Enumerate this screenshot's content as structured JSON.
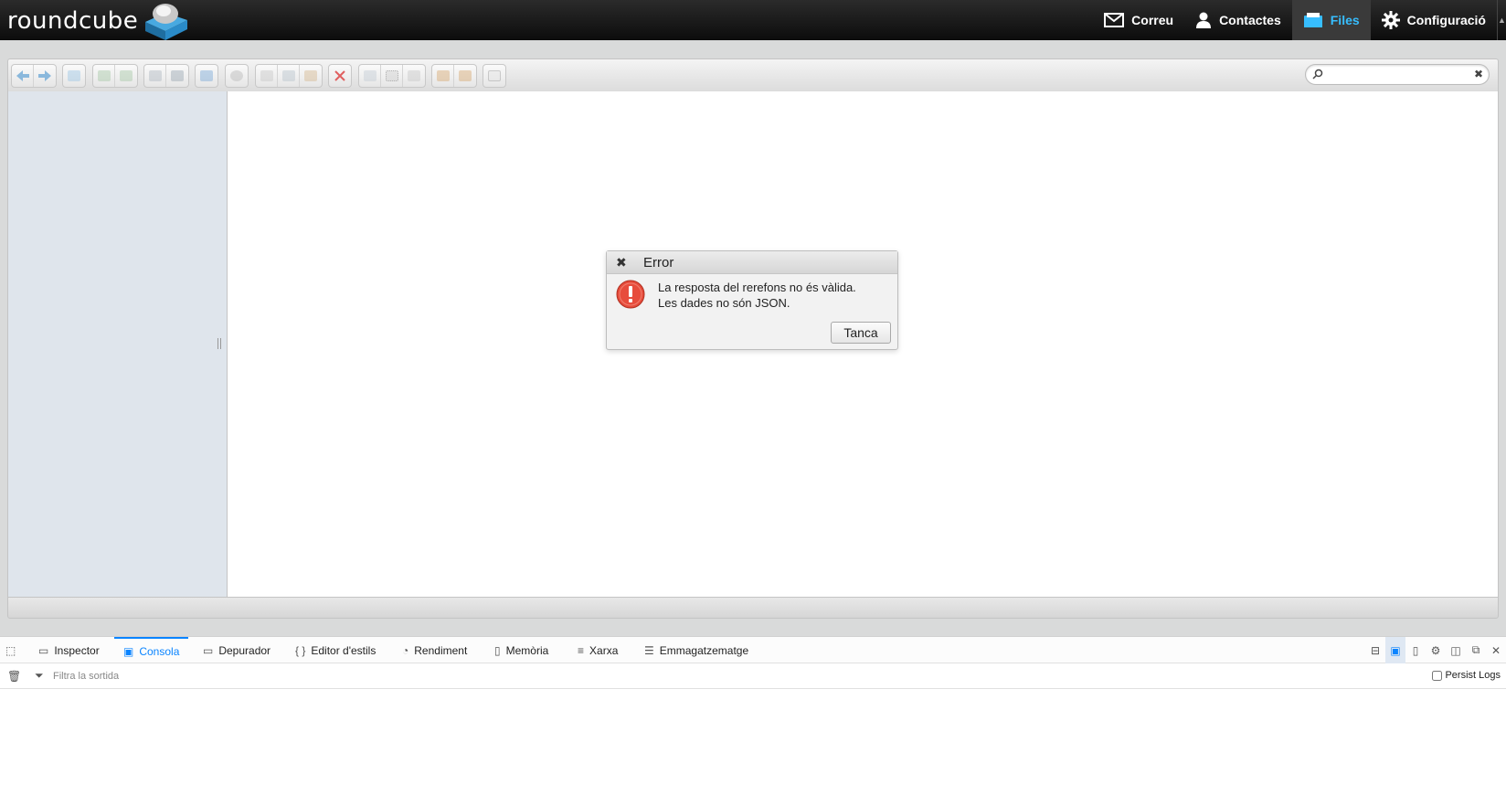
{
  "logo": {
    "text": "roundcube"
  },
  "nav": [
    {
      "label": "Correu",
      "icon": "envelope-icon"
    },
    {
      "label": "Contactes",
      "icon": "user-icon"
    },
    {
      "label": "Files",
      "icon": "folder-icon",
      "active": true
    },
    {
      "label": "Configuració",
      "icon": "gear-icon"
    }
  ],
  "search": {
    "placeholder": "",
    "value": ""
  },
  "dialog": {
    "title": "Error",
    "message_line1": "La resposta del rerefons no és vàlida.",
    "message_line2": "Les dades no són JSON.",
    "button": "Tanca"
  },
  "devtools": {
    "tabs": [
      {
        "label": "Inspector"
      },
      {
        "label": "Consola",
        "active": true
      },
      {
        "label": "Depurador"
      },
      {
        "label": "Editor d'estils"
      },
      {
        "label": "Rendiment"
      },
      {
        "label": "Memòria"
      },
      {
        "label": "Xarxa"
      },
      {
        "label": "Emmagatzematge"
      }
    ],
    "filter_placeholder": "Filtra la sortida",
    "persist_logs": "Persist Logs"
  },
  "colors": {
    "accent": "#37beff",
    "devtools_active": "#0a84ff",
    "error_red": "#e74c3c"
  }
}
